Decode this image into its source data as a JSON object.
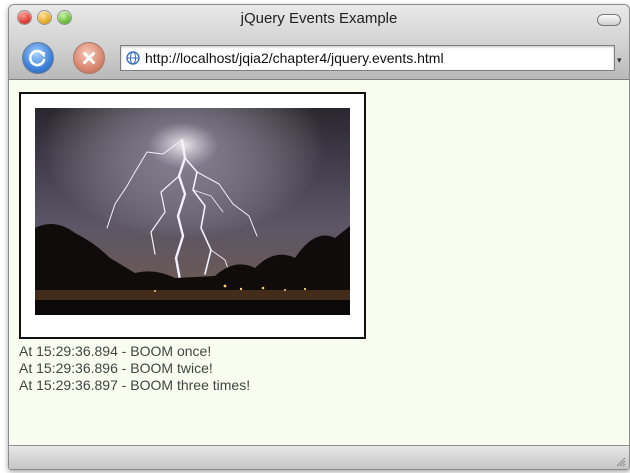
{
  "window": {
    "title": "jQuery Events Example"
  },
  "toolbar": {
    "reload_icon": "reload-icon",
    "stop_icon": "stop-icon",
    "url": "http://localhost/jqia2/chapter4/jquery.events.html"
  },
  "content": {
    "image": "lightning-photo",
    "log": [
      "At 15:29:36.894 - BOOM once!",
      "At 15:29:36.896 - BOOM twice!",
      "At 15:29:36.897 - BOOM three times!"
    ]
  }
}
